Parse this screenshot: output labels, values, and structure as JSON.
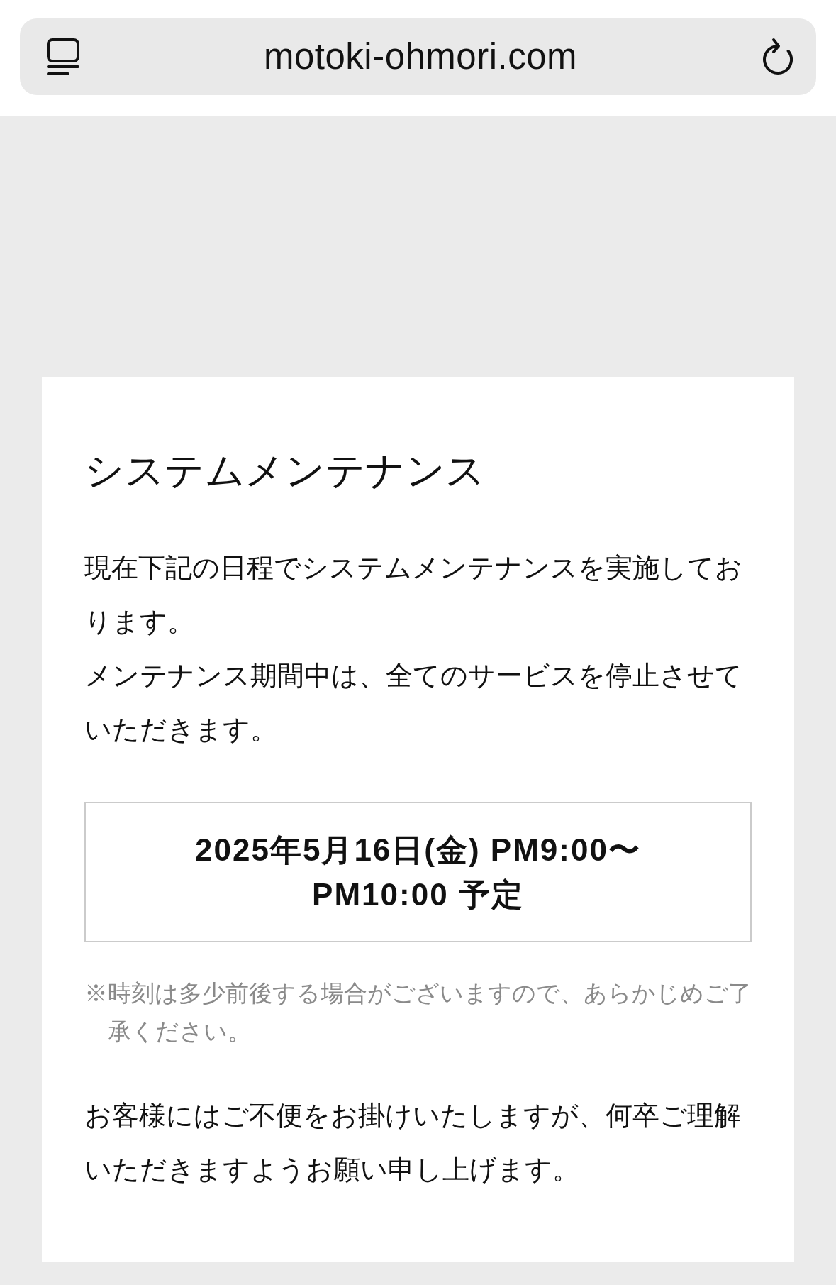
{
  "browser": {
    "url": "motoki-ohmori.com"
  },
  "notice": {
    "title": "システムメンテナンス",
    "paragraphs": [
      "現在下記の日程でシステムメンテナンスを実施しております。",
      "メンテナンス期間中は、全てのサービスを停止させていただきます。"
    ],
    "schedule": "2025年5月16日(金) PM9:00〜\nPM10:00 予定",
    "note": "※時刻は多少前後する場合がございますので、あらかじめご了承ください。",
    "closing": "お客様にはご不便をお掛けいたしますが、何卒ご理解いただきますようお願い申し上げます。"
  }
}
